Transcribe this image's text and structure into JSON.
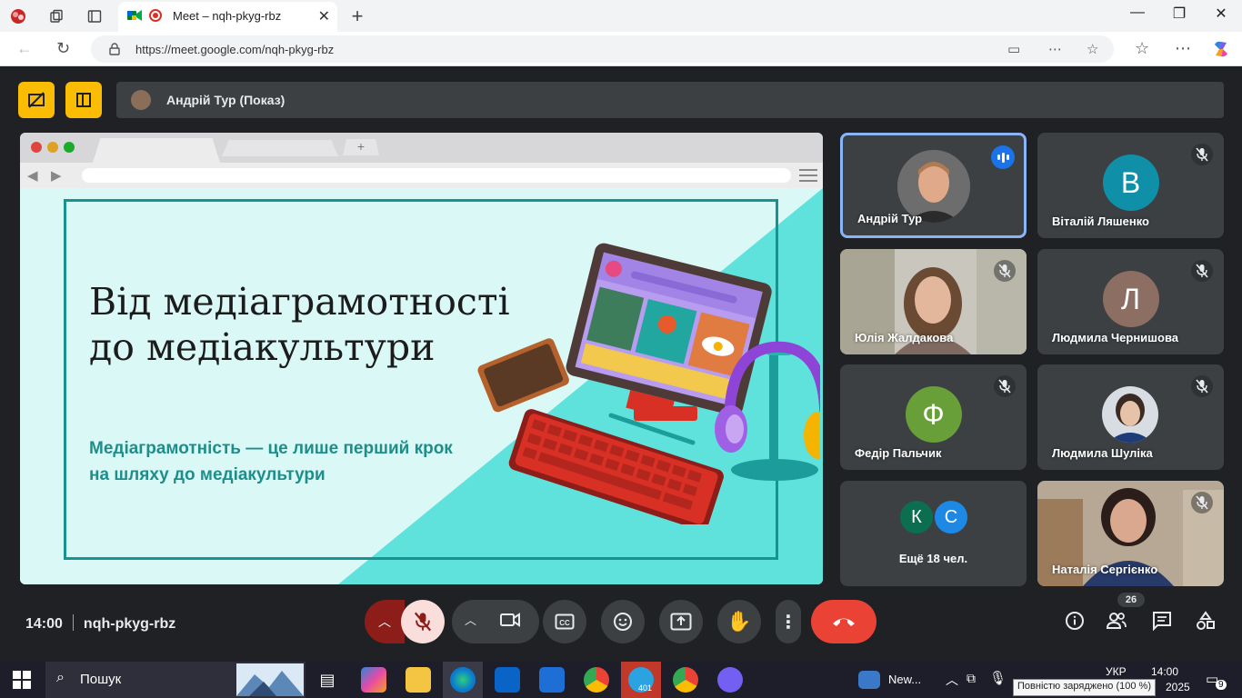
{
  "browser": {
    "tab_title": "Meet – nqh-pkyg-rbz",
    "url": "https://meet.google.com/nqh-pkyg-rbz"
  },
  "meet": {
    "presenter_label": "Андрій Тур (Показ)",
    "meeting_time": "14:00",
    "meeting_code": "nqh-pkyg-rbz",
    "participant_count": "26",
    "slide": {
      "title": "Від медіаграмотності\nдо медіакультури",
      "subtitle": "Медіаграмотність — це лише перший крок\nна шляху до медіакультури"
    },
    "participants": [
      {
        "name": "Андрій Тур",
        "speaking": true
      },
      {
        "name": "Віталій Ляшенко",
        "initial": "В",
        "color": "#0f8fa8"
      },
      {
        "name": "Юлія Жалдакова"
      },
      {
        "name": "Людмила Чернишова",
        "initial": "Л",
        "color": "#8d6e63"
      },
      {
        "name": "Федір Пальчик",
        "initial": "Ф",
        "color": "#689f38"
      },
      {
        "name": "Людмила Шуліка"
      },
      {
        "name": "Наталія Сергієнко"
      }
    ],
    "more": {
      "label": "Ещё 18 чел.",
      "initials": [
        "К",
        "С"
      ],
      "colors": [
        "#0b6e4f",
        "#1e88e5"
      ]
    }
  },
  "taskbar": {
    "search_placeholder": "Пошук",
    "news_label": "New...",
    "telegram_badge": "401",
    "lang": "УКР",
    "clock_time": "14:00",
    "clock_date": "2025",
    "notifications": "9",
    "battery_tooltip": "Повністю заряджено (100 %)"
  }
}
